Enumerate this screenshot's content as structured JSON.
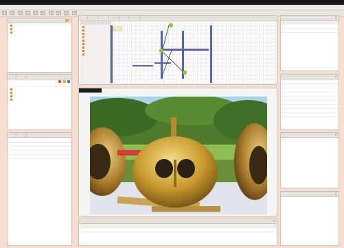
{
  "menu": [
    "",
    "",
    "",
    ""
  ],
  "toolbar_count": 10,
  "left_top_panel": {
    "title": "",
    "items": [
      "",
      "",
      ""
    ]
  },
  "left_mid_panel": {
    "tabs": [
      "",
      ""
    ],
    "items": [
      "",
      "",
      "",
      ""
    ]
  },
  "left_bottom_panel": {
    "tabs": [
      "",
      ""
    ],
    "rows": [
      [
        "",
        ""
      ],
      [
        "",
        ""
      ],
      [
        "",
        ""
      ],
      [
        "",
        ""
      ]
    ]
  },
  "diagram": {
    "tabs": [
      "",
      "",
      "",
      "",
      "",
      ""
    ],
    "palette_title": "",
    "palette_items": [
      "",
      "",
      "",
      "",
      "",
      "",
      "",
      "",
      ""
    ]
  },
  "image_view": {
    "title": ""
  },
  "bottom_panel": {
    "title": "",
    "header": [
      "",
      ""
    ],
    "row": [
      "",
      ""
    ]
  },
  "right_top_panel": {
    "title": "",
    "header": [
      "",
      ""
    ],
    "rows": [
      [
        "",
        ""
      ],
      [
        "",
        ""
      ]
    ]
  },
  "right_mid_panel": {
    "title": "",
    "rows": [
      [
        "",
        "",
        ""
      ],
      [
        "",
        "",
        ""
      ],
      [
        "",
        "",
        ""
      ],
      [
        "",
        "",
        ""
      ],
      [
        "",
        "",
        ""
      ],
      [
        "",
        "",
        ""
      ],
      [
        "",
        "",
        ""
      ],
      [
        "",
        "",
        ""
      ]
    ]
  },
  "right_small_panel": {
    "title": ""
  },
  "right_bottom_panel": {
    "title": ""
  },
  "colors": {
    "accent_orange": "#e8a23a",
    "close_red": "#d94a3a",
    "link_blue": "#4a6fb5"
  }
}
